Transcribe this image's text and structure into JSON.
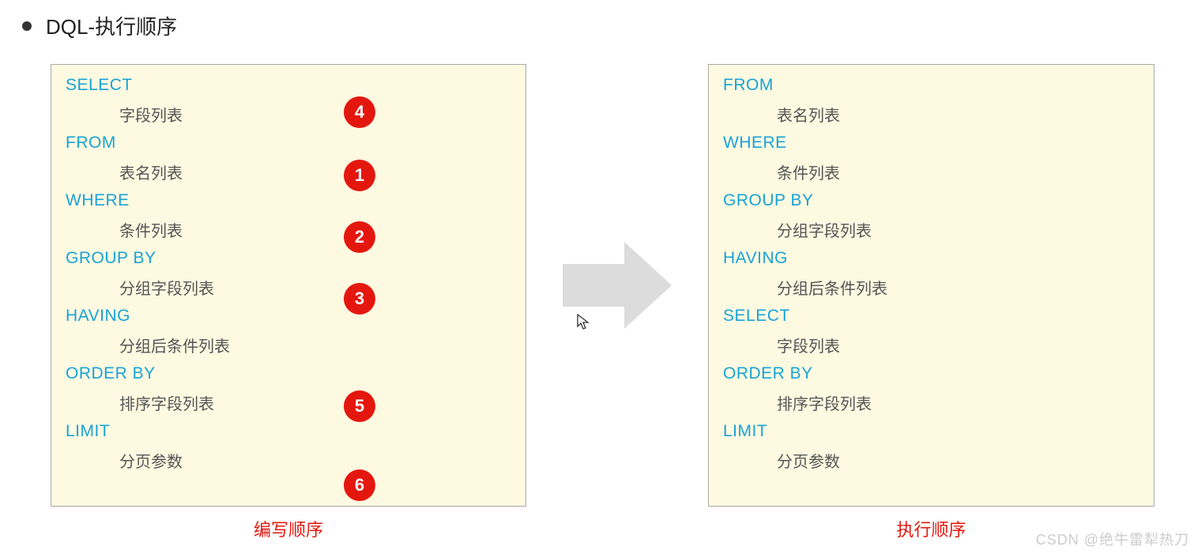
{
  "header": {
    "title": "DQL-执行顺序"
  },
  "left_panel": {
    "caption": "编写顺序",
    "clauses": [
      {
        "keyword": "SELECT",
        "desc": "字段列表",
        "badge": "4"
      },
      {
        "keyword": "FROM",
        "desc": "表名列表",
        "badge": "1"
      },
      {
        "keyword": "WHERE",
        "desc": "条件列表",
        "badge": "2"
      },
      {
        "keyword": "GROUP  BY",
        "desc": "分组字段列表",
        "badge": "3"
      },
      {
        "keyword": "HAVING",
        "desc": "分组后条件列表",
        "badge": ""
      },
      {
        "keyword": "ORDER BY",
        "desc": "排序字段列表",
        "badge": "5"
      },
      {
        "keyword": "LIMIT",
        "desc": "分页参数",
        "badge": "6"
      }
    ]
  },
  "right_panel": {
    "caption": "执行顺序",
    "clauses": [
      {
        "keyword": "FROM",
        "desc": "表名列表"
      },
      {
        "keyword": "WHERE",
        "desc": "条件列表"
      },
      {
        "keyword": "GROUP  BY",
        "desc": "分组字段列表"
      },
      {
        "keyword": "HAVING",
        "desc": "分组后条件列表"
      },
      {
        "keyword": " SELECT",
        "desc": "字段列表"
      },
      {
        "keyword": "ORDER BY",
        "desc": "排序字段列表"
      },
      {
        "keyword": "LIMIT",
        "desc": "分页参数"
      }
    ]
  },
  "watermark": "CSDN @绝牛雷犁热刀"
}
